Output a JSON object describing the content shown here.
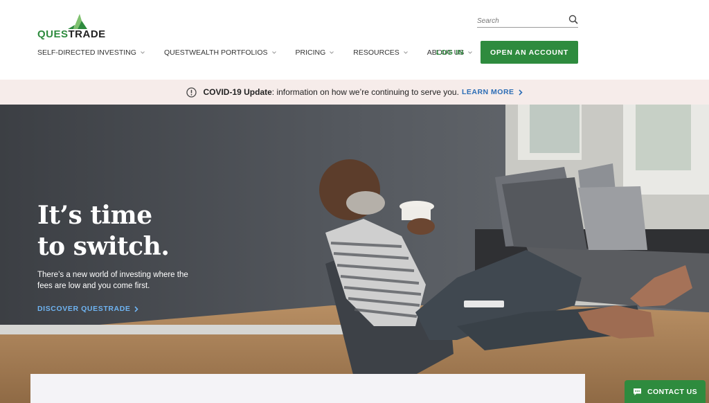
{
  "brand": {
    "name": "QUESTRADE",
    "name_part1": "QUES",
    "name_part2": "TRADE",
    "color": "#2e8b3e"
  },
  "search": {
    "placeholder": "Search"
  },
  "nav": {
    "items": [
      {
        "label": "SELF-DIRECTED INVESTING"
      },
      {
        "label": "QUESTWEALTH PORTFOLIOS"
      },
      {
        "label": "PRICING"
      },
      {
        "label": "RESOURCES"
      },
      {
        "label": "ABOUT US"
      }
    ],
    "login_label": "LOG IN",
    "cta_label": "OPEN AN ACCOUNT"
  },
  "banner": {
    "bold": "COVID-19 Update",
    "text": ": information on how we’re continuing to serve you.",
    "link_label": "LEARN MORE"
  },
  "hero": {
    "headline_line1": "It’s time",
    "headline_line2": "to switch.",
    "subtext": "There’s a new world of investing where the fees are low and you come first.",
    "link_label": "DISCOVER QUESTRADE"
  },
  "contact": {
    "label": "CONTACT US"
  },
  "colors": {
    "primary_green": "#2e8b3e",
    "link_blue": "#2c6db5",
    "banner_bg": "#f6ecea"
  }
}
